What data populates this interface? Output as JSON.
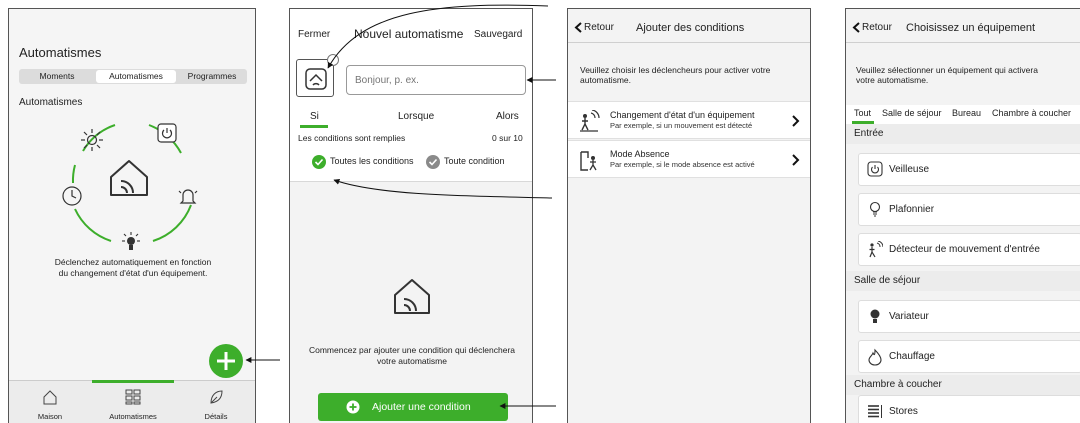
{
  "screen_automations": {
    "title": "Automatismes",
    "segments": [
      "Moments",
      "Automatismes",
      "Programmes"
    ],
    "active_segment": 1,
    "section_title": "Automatismes",
    "description_line1": "Déclenchez automatiquement en fonction",
    "description_line2": "du changement d'état d'un équipement.",
    "nav": [
      {
        "label": "Maison",
        "icon": "house-icon"
      },
      {
        "label": "Automatismes",
        "icon": "grid-icon"
      },
      {
        "label": "Détails",
        "icon": "leaf-icon"
      }
    ],
    "active_nav": 1
  },
  "screen_new_automation": {
    "close_label": "Fermer",
    "title": "Nouvel automatisme",
    "save_label": "Sauvegard",
    "name_placeholder": "Bonjour, p. ex.",
    "columns": [
      "Si",
      "Lorsque",
      "Alors"
    ],
    "conditions_label": "Les conditions sont remplies",
    "conditions_count": "0 sur 10",
    "option_all": "Toutes les conditions",
    "option_any": "Toute condition",
    "empty_line1": "Commencez par ajouter une condition qui déclenchera",
    "empty_line2": "votre automatisme",
    "add_condition_label": "Ajouter une condition"
  },
  "screen_add_conditions": {
    "back_label": "Retour",
    "title": "Ajouter des conditions",
    "intro_line1": "Veuillez choisir les déclencheurs pour activer votre",
    "intro_line2": "automatisme.",
    "items": [
      {
        "title": "Changement d'état d'un équipement",
        "subtitle": "Par exemple, si un mouvement est détecté",
        "icon": "motion-sensor-icon"
      },
      {
        "title": "Mode Absence",
        "subtitle": "Par exemple, si le mode absence est activé",
        "icon": "absence-mode-icon"
      }
    ]
  },
  "screen_choose_device": {
    "back_label": "Retour",
    "title": "Choisissez un équipement",
    "intro_line1": "Veuillez sélectionner un équipement qui activera",
    "intro_line2": "votre automatisme.",
    "tabs": [
      "Tout",
      "Salle de séjour",
      "Bureau",
      "Chambre à coucher"
    ],
    "active_tab": 0,
    "sections": [
      {
        "title": "Entrée",
        "devices": [
          "Veilleuse",
          "Plafonnier",
          "Détecteur de mouvement d'entrée"
        ]
      },
      {
        "title": "Salle de séjour",
        "devices": [
          "Variateur",
          "Chauffage"
        ]
      },
      {
        "title": "Chambre à coucher",
        "devices": [
          "Stores"
        ]
      }
    ]
  },
  "colors": {
    "accent": "#3dae2b",
    "background": "#f5f5f5",
    "text": "#333333"
  }
}
